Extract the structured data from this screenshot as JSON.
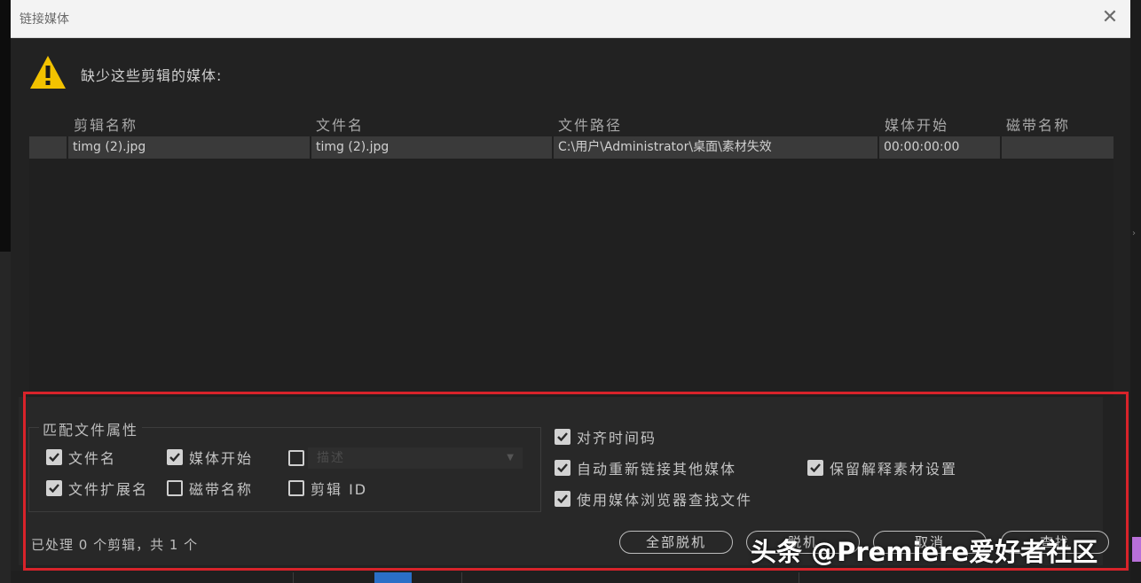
{
  "dialog": {
    "title": "链接媒体",
    "close_icon": "close-icon",
    "warning_icon": "warning-triangle-icon",
    "warning_text": "缺少这些剪辑的媒体:"
  },
  "table": {
    "columns": [
      "剪辑名称",
      "文件名",
      "文件路径",
      "媒体开始",
      "磁带名称"
    ],
    "rows": [
      [
        "timg (2).jpg",
        "timg (2).jpg",
        "C:\\用户\\Administrator\\桌面\\素材失效",
        "00:00:00:00",
        ""
      ]
    ]
  },
  "match": {
    "legend": "匹配文件属性",
    "filename": {
      "label": "文件名",
      "checked": true
    },
    "media_start": {
      "label": "媒体开始",
      "checked": true
    },
    "description": {
      "label": "描述",
      "checked": false
    },
    "file_extension": {
      "label": "文件扩展名",
      "checked": true
    },
    "tape_name": {
      "label": "磁带名称",
      "checked": false
    },
    "clip_id": {
      "label": "剪辑 ID",
      "checked": false
    }
  },
  "options": {
    "align_timecode": {
      "label": "对齐时间码",
      "checked": true
    },
    "auto_relink": {
      "label": "自动重新链接其他媒体",
      "checked": true
    },
    "use_media_browser": {
      "label": "使用媒体浏览器查找文件",
      "checked": true
    },
    "preserve_interpret": {
      "label": "保留解释素材设置",
      "checked": true
    }
  },
  "status": "已处理 0 个剪辑，共 1 个",
  "buttons": {
    "offline_all": "全部脱机",
    "offline": "脱机",
    "cancel": "取消",
    "find": "查找"
  },
  "watermark": "头条 @Premiere爱好者社区",
  "colors": {
    "highlight_border": "#d8232a",
    "warning_yellow": "#f2c200",
    "row_selected": "#3a3a3a",
    "timeline_blue": "#2a6fc7",
    "timeline_pink": "#b86fd8"
  }
}
